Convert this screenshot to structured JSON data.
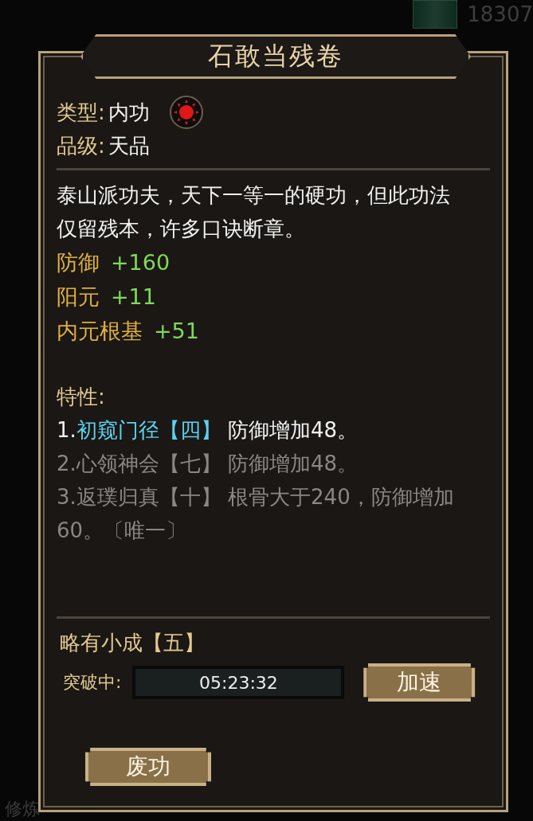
{
  "background": {
    "currency": "18307",
    "tab_label": "修炼"
  },
  "dialog": {
    "title": "石敢当残卷",
    "info": [
      {
        "label": "类型",
        "sep": ":",
        "value": "内功",
        "kind": "type"
      },
      {
        "label": "品级",
        "sep": ":",
        "value": "天品",
        "kind": "plain"
      }
    ],
    "description": "泰山派功夫，天下一等一的硬功，但此功法仅留残本，许多口诀断章。",
    "stats": [
      {
        "name": "防御",
        "value": "+160"
      },
      {
        "name": "阳元",
        "value": "+11"
      },
      {
        "name": "内元根基",
        "value": "+51"
      }
    ],
    "traits_heading": "特性:",
    "traits": [
      {
        "number": "1.",
        "name": "初窥门径【四】",
        "effect": "防御增加48。",
        "active": true
      },
      {
        "number": "2.",
        "name": "心领神会【七】",
        "effect": "防御增加48。",
        "active": false
      },
      {
        "number": "3.",
        "name": "返璞归真【十】",
        "effect": "根骨大于240，防御增加60。〔唯一〕",
        "active": false
      }
    ],
    "level": "略有小成【五】",
    "progress_label": "突破中:",
    "timer": "05:23:32",
    "speed_button": "加速",
    "abandon_button": "废功"
  }
}
